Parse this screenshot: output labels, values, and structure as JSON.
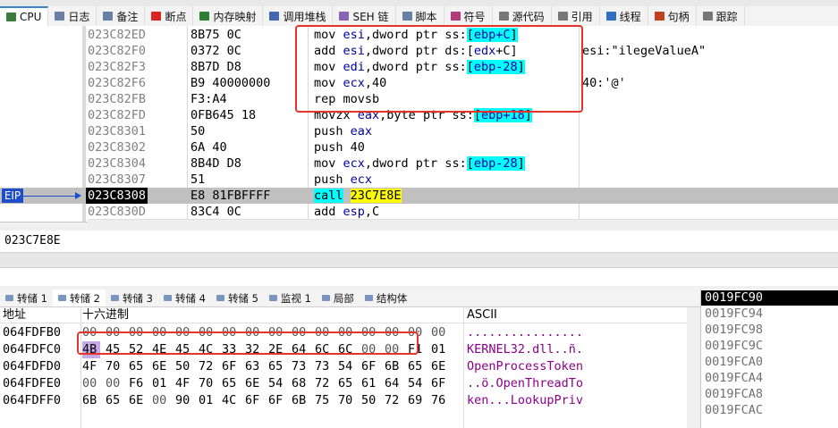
{
  "tabs": [
    {
      "label": "CPU",
      "icon": "cpu-icon",
      "color": "#3d7a3d",
      "active": true
    },
    {
      "label": "日志",
      "icon": "log-icon",
      "color": "#6a7fa6"
    },
    {
      "label": "备注",
      "icon": "notes-icon",
      "color": "#6a7fa6"
    },
    {
      "label": "断点",
      "icon": "breakpoint-icon",
      "color": "#d22"
    },
    {
      "label": "内存映射",
      "icon": "memory-map-icon",
      "color": "#2e7d32"
    },
    {
      "label": "调用堆栈",
      "icon": "call-stack-icon",
      "color": "#4468b0"
    },
    {
      "label": "SEH 链",
      "icon": "seh-chain-icon",
      "color": "#8a63b5"
    },
    {
      "label": "脚本",
      "icon": "script-icon",
      "color": "#6a7fa6"
    },
    {
      "label": "符号",
      "icon": "symbols-icon",
      "color": "#b03a7a"
    },
    {
      "label": "源代码",
      "icon": "source-icon",
      "color": "#777"
    },
    {
      "label": "引用",
      "icon": "references-icon",
      "color": "#777"
    },
    {
      "label": "线程",
      "icon": "threads-icon",
      "color": "#3070c0"
    },
    {
      "label": "句柄",
      "icon": "handles-icon",
      "color": "#c04020"
    },
    {
      "label": "跟踪",
      "icon": "trace-icon",
      "color": "#777"
    }
  ],
  "disasm": {
    "rows": [
      {
        "addr": "023C82ED",
        "bytes": "8B75 0C",
        "instr": [
          [
            "mov ",
            ""
          ],
          [
            "esi",
            "reg"
          ],
          [
            ",dword ptr ss:",
            ""
          ],
          [
            "[",
            "hl"
          ],
          [
            "ebp+C",
            "hlreg"
          ],
          [
            "]",
            "hl"
          ]
        ],
        "comment": ""
      },
      {
        "addr": "023C82F0",
        "bytes": "0372 0C",
        "instr": [
          [
            "add ",
            ""
          ],
          [
            "esi",
            "reg"
          ],
          [
            ",dword ptr ds:[",
            ""
          ],
          [
            "edx",
            "reg"
          ],
          [
            "+C]",
            ""
          ]
        ],
        "comment": "esi:\"ilegeValueA\""
      },
      {
        "addr": "023C82F3",
        "bytes": "8B7D D8",
        "instr": [
          [
            "mov ",
            ""
          ],
          [
            "edi",
            "reg"
          ],
          [
            ",dword ptr ss:",
            ""
          ],
          [
            "[",
            "hl"
          ],
          [
            "ebp-28",
            "hlreg"
          ],
          [
            "]",
            "hl"
          ]
        ],
        "comment": ""
      },
      {
        "addr": "023C82F6",
        "bytes": "B9 40000000",
        "instr": [
          [
            "mov ",
            ""
          ],
          [
            "ecx",
            "reg"
          ],
          [
            ",40",
            ""
          ]
        ],
        "comment": "40:'@'"
      },
      {
        "addr": "023C82FB",
        "bytes": "F3:A4",
        "instr": [
          [
            "rep movsb",
            ""
          ]
        ],
        "comment": ""
      },
      {
        "addr": "023C82FD",
        "bytes": "0FB645 18",
        "instr": [
          [
            "movzx ",
            ""
          ],
          [
            "eax",
            "reg"
          ],
          [
            ",byte ptr ss:",
            ""
          ],
          [
            "[",
            "hl"
          ],
          [
            "ebp+18",
            "hlreg"
          ],
          [
            "]",
            "hl"
          ]
        ],
        "comment": ""
      },
      {
        "addr": "023C8301",
        "bytes": "50",
        "instr": [
          [
            "push ",
            ""
          ],
          [
            "eax",
            "reg"
          ]
        ],
        "comment": ""
      },
      {
        "addr": "023C8302",
        "bytes": "6A 40",
        "instr": [
          [
            "push ",
            ""
          ],
          [
            "40",
            ""
          ]
        ],
        "comment": ""
      },
      {
        "addr": "023C8304",
        "bytes": "8B4D D8",
        "instr": [
          [
            "mov ",
            ""
          ],
          [
            "ecx",
            "reg"
          ],
          [
            ",dword ptr ss:",
            ""
          ],
          [
            "[",
            "hl"
          ],
          [
            "ebp-28",
            "hlreg"
          ],
          [
            "]",
            "hl"
          ]
        ],
        "comment": ""
      },
      {
        "addr": "023C8307",
        "bytes": "51",
        "instr": [
          [
            "push ",
            ""
          ],
          [
            "ecx",
            "reg"
          ]
        ],
        "comment": ""
      },
      {
        "addr": "023C8308",
        "bytes": "E8 81FBFFFF",
        "instr": [
          [
            "call",
            "call"
          ],
          [
            " ",
            ""
          ],
          [
            "23C7E8E",
            "target"
          ]
        ],
        "comment": "",
        "current": true
      },
      {
        "addr": "023C830D",
        "bytes": "83C4 0C",
        "instr": [
          [
            "add ",
            ""
          ],
          [
            "esp",
            "reg"
          ],
          [
            ",C",
            ""
          ]
        ],
        "comment": ""
      }
    ],
    "eip_label": "EIP"
  },
  "info": {
    "text": "023C7E8E"
  },
  "dump_tabs": [
    {
      "label": "转储 1"
    },
    {
      "label": "转储 2",
      "active": true
    },
    {
      "label": "转储 3"
    },
    {
      "label": "转储 4"
    },
    {
      "label": "转储 5"
    },
    {
      "label": "监视 1"
    },
    {
      "label": "局部"
    },
    {
      "label": "结构体"
    }
  ],
  "dump": {
    "headers": {
      "address": "地址",
      "hex": "十六进制",
      "ascii": "ASCII"
    },
    "rows": [
      {
        "addr": "064FDFB0",
        "bytes": [
          "00",
          "00",
          "00",
          "00",
          "00",
          "00",
          "00",
          "00",
          "00",
          "00",
          "00",
          "00",
          "00",
          "00",
          "00",
          "00"
        ],
        "ascii": "................"
      },
      {
        "addr": "064FDFC0",
        "bytes": [
          "4B",
          "45",
          "52",
          "4E",
          "45",
          "4C",
          "33",
          "32",
          "2E",
          "64",
          "6C",
          "6C",
          "00",
          "00",
          "F1",
          "01"
        ],
        "ascii": "KERNEL32.dll..ñ."
      },
      {
        "addr": "064FDFD0",
        "bytes": [
          "4F",
          "70",
          "65",
          "6E",
          "50",
          "72",
          "6F",
          "63",
          "65",
          "73",
          "73",
          "54",
          "6F",
          "6B",
          "65",
          "6E"
        ],
        "ascii": "OpenProcessToken"
      },
      {
        "addr": "064FDFE0",
        "bytes": [
          "00",
          "00",
          "F6",
          "01",
          "4F",
          "70",
          "65",
          "6E",
          "54",
          "68",
          "72",
          "65",
          "61",
          "64",
          "54",
          "6F"
        ],
        "ascii": "..ö.OpenThreadTo"
      },
      {
        "addr": "064FDFF0",
        "bytes": [
          "6B",
          "65",
          "6E",
          "00",
          "90",
          "01",
          "4C",
          "6F",
          "6F",
          "6B",
          "75",
          "70",
          "50",
          "72",
          "69",
          "76"
        ],
        "ascii": "ken...LookupPriv"
      }
    ]
  },
  "stack": {
    "rows": [
      "0019FC90",
      "0019FC94",
      "0019FC98",
      "0019FC9C",
      "0019FCA0",
      "0019FCA4",
      "0019FCA8",
      "0019FCAC"
    ]
  }
}
